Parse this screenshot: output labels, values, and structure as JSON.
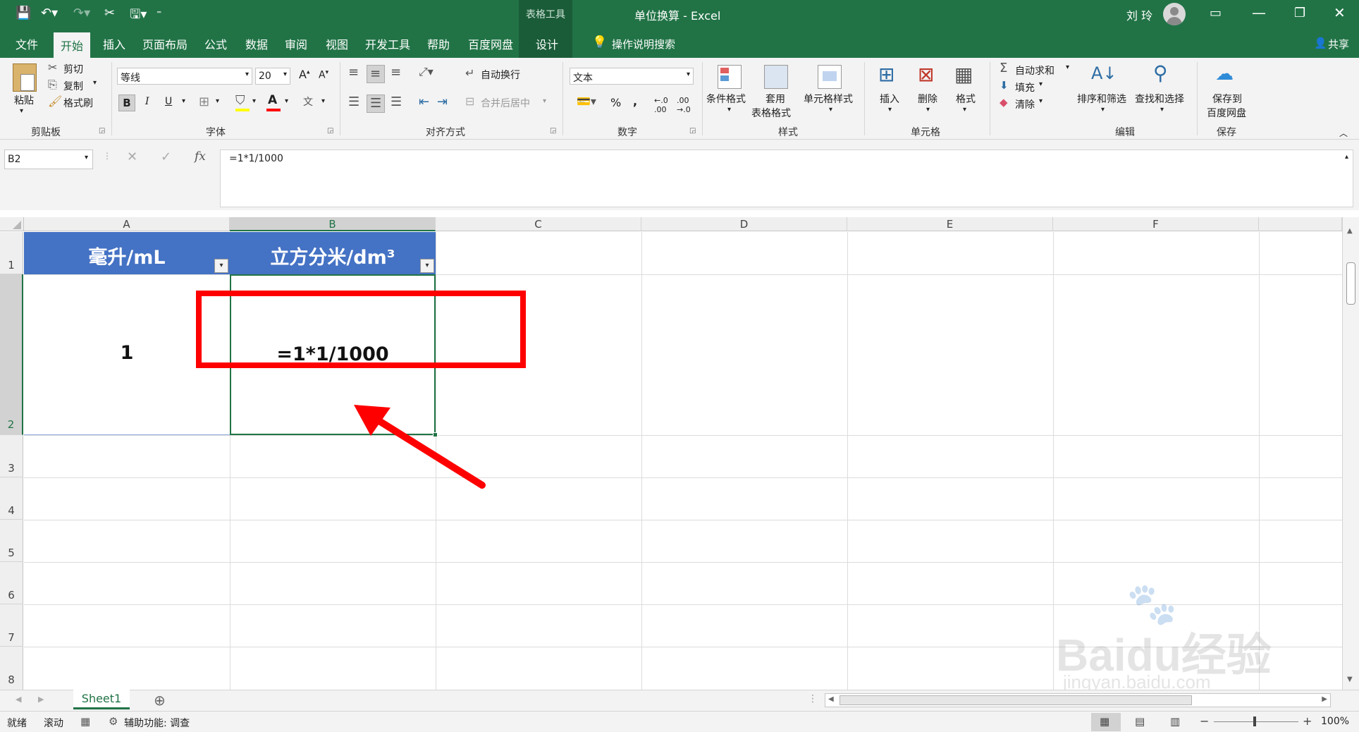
{
  "title_bar": {
    "context_tool": "表格工具",
    "doc_title": "单位换算 - Excel",
    "user_name": "刘 玲"
  },
  "tabs": [
    "文件",
    "开始",
    "插入",
    "页面布局",
    "公式",
    "数据",
    "审阅",
    "视图",
    "开发工具",
    "帮助",
    "百度网盘",
    "设计"
  ],
  "active_tab": "开始",
  "tell_me": "操作说明搜索",
  "share": "共享",
  "ribbon": {
    "clipboard": {
      "paste": "粘贴",
      "cut": "剪切",
      "copy": "复制",
      "format_painter": "格式刷",
      "group": "剪贴板"
    },
    "font": {
      "name": "等线",
      "size": "20",
      "bold": "B",
      "italic": "I",
      "underline": "U",
      "group": "字体"
    },
    "alignment": {
      "wrap": "自动换行",
      "merge": "合并后居中",
      "group": "对齐方式"
    },
    "number": {
      "format": "文本",
      "percent": "%",
      "comma": ",",
      "group": "数字"
    },
    "styles": {
      "conditional": "条件格式",
      "table_l1": "套用",
      "table_l2": "表格格式",
      "cell_styles": "单元格样式",
      "group": "样式"
    },
    "cells": {
      "insert": "插入",
      "delete": "删除",
      "format": "格式",
      "group": "单元格"
    },
    "editing": {
      "autosum": "自动求和",
      "fill": "填充",
      "clear": "清除",
      "sort": "排序和筛选",
      "find": "查找和选择",
      "group": "编辑"
    },
    "save": {
      "l1": "保存到",
      "l2": "百度网盘",
      "group": "保存"
    }
  },
  "formula_bar": {
    "name_box": "B2",
    "fx": "fx",
    "formula": "=1*1/1000"
  },
  "columns": [
    "A",
    "B",
    "C",
    "D",
    "E",
    "F"
  ],
  "rows": [
    "1",
    "2",
    "3",
    "4",
    "5",
    "6",
    "7",
    "8"
  ],
  "cells": {
    "A1": "毫升/mL",
    "B1": "立方分米/dm³",
    "A2": "1",
    "B2": "=1*1/1000"
  },
  "sheet_tabs": [
    "Sheet1"
  ],
  "status": {
    "ready": "就绪",
    "scroll": "滚动",
    "accessibility": "辅助功能: 调查",
    "zoom": "100%"
  },
  "watermark": {
    "brand": "Baidu经验",
    "url": "jingyan.baidu.com"
  },
  "colors": {
    "excel_green": "#217346",
    "header_fill": "#4472c4",
    "annotation_red": "#ff0000",
    "active_border": "#217346"
  }
}
